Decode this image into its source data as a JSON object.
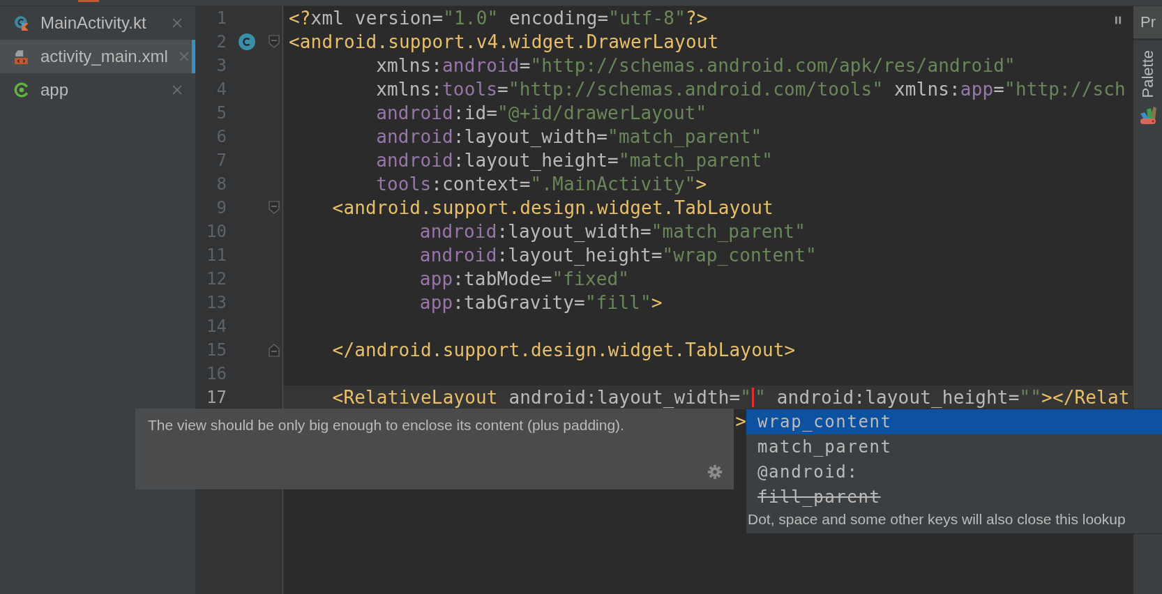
{
  "file_tabs": [
    {
      "name": "MainActivity.kt",
      "kind": "kotlin",
      "selected": false
    },
    {
      "name": "activity_main.xml",
      "kind": "layout",
      "selected": true
    },
    {
      "name": "app",
      "kind": "module",
      "selected": false
    }
  ],
  "side_strip": {
    "top_tab": "Pr",
    "tool_window": "Palette"
  },
  "editor": {
    "lines": [
      {
        "number": "1",
        "kind": "root",
        "current": false,
        "tokens": [
          {
            "kind": "tag",
            "text": "<?"
          },
          {
            "kind": "plain",
            "text": "xml version="
          },
          {
            "kind": "value",
            "text": "\"1.0\""
          },
          {
            "kind": "plain",
            "text": " encoding="
          },
          {
            "kind": "value",
            "text": "\"utf-8\""
          },
          {
            "kind": "tag",
            "text": "?>"
          }
        ]
      },
      {
        "number": "2",
        "kind": "root",
        "current": false,
        "class_marker": true,
        "fold_start": true,
        "tokens": [
          {
            "kind": "tag",
            "text": "<android.support.v4.widget.DrawerLayout"
          }
        ]
      },
      {
        "number": "3",
        "kind": "attribute",
        "current": false,
        "tokens": [
          {
            "kind": "plain",
            "text": "xmlns:"
          },
          {
            "kind": "ns",
            "text": "android"
          },
          {
            "kind": "plain",
            "text": "="
          },
          {
            "kind": "value",
            "text": "\"http://schemas.android.com/apk/res/android\""
          }
        ]
      },
      {
        "number": "4",
        "kind": "attribute",
        "current": false,
        "tokens": [
          {
            "kind": "plain",
            "text": "xmlns:"
          },
          {
            "kind": "ns",
            "text": "tools"
          },
          {
            "kind": "plain",
            "text": "="
          },
          {
            "kind": "value",
            "text": "\"http://schemas.android.com/tools\""
          },
          {
            "kind": "plain",
            "text": " xmlns:"
          },
          {
            "kind": "ns",
            "text": "app"
          },
          {
            "kind": "plain",
            "text": "="
          },
          {
            "kind": "value",
            "text": "\"http://sch"
          }
        ]
      },
      {
        "number": "5",
        "kind": "attribute",
        "current": false,
        "tokens": [
          {
            "kind": "ns",
            "text": "android"
          },
          {
            "kind": "plain",
            "text": ":id="
          },
          {
            "kind": "value",
            "text": "\"@+id/drawerLayout\""
          }
        ]
      },
      {
        "number": "6",
        "kind": "attribute",
        "current": false,
        "tokens": [
          {
            "kind": "ns",
            "text": "android"
          },
          {
            "kind": "plain",
            "text": ":layout_width="
          },
          {
            "kind": "value",
            "text": "\"match_parent\""
          }
        ]
      },
      {
        "number": "7",
        "kind": "attribute",
        "current": false,
        "tokens": [
          {
            "kind": "ns",
            "text": "android"
          },
          {
            "kind": "plain",
            "text": ":layout_height="
          },
          {
            "kind": "value",
            "text": "\"match_parent\""
          }
        ]
      },
      {
        "number": "8",
        "kind": "attribute",
        "current": false,
        "tokens": [
          {
            "kind": "ns",
            "text": "tools"
          },
          {
            "kind": "plain",
            "text": ":context="
          },
          {
            "kind": "value",
            "text": "\".MainActivity\""
          },
          {
            "kind": "tag",
            "text": ">"
          }
        ]
      },
      {
        "number": "9",
        "kind": "child",
        "current": false,
        "fold_start": true,
        "tokens": [
          {
            "kind": "tag",
            "text": "<android.support.design.widget.TabLayout"
          }
        ]
      },
      {
        "number": "10",
        "kind": "child_attribute",
        "current": false,
        "tokens": [
          {
            "kind": "ns",
            "text": "android"
          },
          {
            "kind": "plain",
            "text": ":layout_width="
          },
          {
            "kind": "value",
            "text": "\"match_parent\""
          }
        ]
      },
      {
        "number": "11",
        "kind": "child_attribute",
        "current": false,
        "tokens": [
          {
            "kind": "ns",
            "text": "android"
          },
          {
            "kind": "plain",
            "text": ":layout_height="
          },
          {
            "kind": "value",
            "text": "\"wrap_content\""
          }
        ]
      },
      {
        "number": "12",
        "kind": "child_attribute",
        "current": false,
        "tokens": [
          {
            "kind": "ns",
            "text": "app"
          },
          {
            "kind": "plain",
            "text": ":tabMode="
          },
          {
            "kind": "value",
            "text": "\"fixed\""
          }
        ]
      },
      {
        "number": "13",
        "kind": "child_attribute",
        "current": false,
        "tokens": [
          {
            "kind": "ns",
            "text": "app"
          },
          {
            "kind": "plain",
            "text": ":tabGravity="
          },
          {
            "kind": "value",
            "text": "\"fill\""
          },
          {
            "kind": "tag",
            "text": ">"
          }
        ]
      },
      {
        "number": "14",
        "kind": "root",
        "current": false
      },
      {
        "number": "15",
        "kind": "child",
        "current": false,
        "fold_end": true,
        "tokens": [
          {
            "kind": "tag",
            "text": "</android.support.design.widget.TabLayout>"
          }
        ]
      },
      {
        "number": "16",
        "kind": "root",
        "current": false
      },
      {
        "number": "17",
        "kind": "child",
        "current": true,
        "tokens": [
          {
            "kind": "tag",
            "text": "<RelativeLayout"
          },
          {
            "kind": "plain",
            "text": " android:layout_width="
          },
          {
            "kind": "value",
            "text": "\""
          },
          {
            "kind": "caret"
          },
          {
            "kind": "value",
            "text": "\""
          },
          {
            "kind": "plain",
            "text": " android:layout_height="
          },
          {
            "kind": "value",
            "text": "\"\""
          },
          {
            "kind": "tag",
            "text": "></Relat"
          }
        ]
      },
      {
        "kind": "tail",
        "current": false,
        "tokens": [
          {
            "kind": "tag",
            "text": ">"
          }
        ]
      }
    ]
  },
  "documentation_popup": {
    "text": "The view should be only big enough to enclose its content (plus padding)."
  },
  "completion_popup": {
    "items": [
      {
        "text": "wrap_content",
        "selected": true,
        "deprecated": false
      },
      {
        "text": "match_parent",
        "selected": false,
        "deprecated": false
      },
      {
        "text": "@android:",
        "selected": false,
        "deprecated": false
      },
      {
        "text": "fill_parent",
        "selected": false,
        "deprecated": true
      }
    ],
    "hint": "Dot, space and some other keys will also close this lookup"
  }
}
